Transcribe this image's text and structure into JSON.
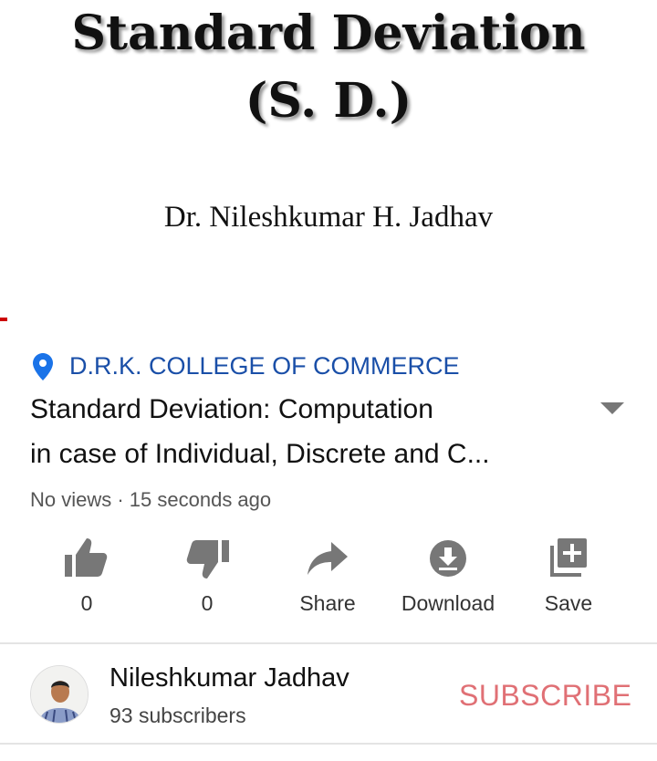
{
  "video_frame": {
    "title_line1": "Standard Deviation",
    "title_line2": "(S. D.)",
    "author": "Dr. Nileshkumar H. Jadhav",
    "progress_color": "#cc0000"
  },
  "location": {
    "icon": "location-pin-icon",
    "label": "D.R.K. COLLEGE OF COMMERCE",
    "color": "#1a4fa8"
  },
  "video": {
    "title_line1": "Standard Deviation: Computation",
    "title_line2": "in case of Individual, Discrete and C...",
    "meta": "No views · 15 seconds ago"
  },
  "actions": [
    {
      "icon": "thumbs-up-icon",
      "label": "0"
    },
    {
      "icon": "thumbs-down-icon",
      "label": "0"
    },
    {
      "icon": "share-icon",
      "label": "Share"
    },
    {
      "icon": "download-icon",
      "label": "Download"
    },
    {
      "icon": "save-playlist-icon",
      "label": "Save"
    }
  ],
  "channel": {
    "name": "Nileshkumar Jadhav",
    "subscribers": "93 subscribers",
    "subscribe_label": "SUBSCRIBE",
    "subscribe_color": "#e07075"
  }
}
